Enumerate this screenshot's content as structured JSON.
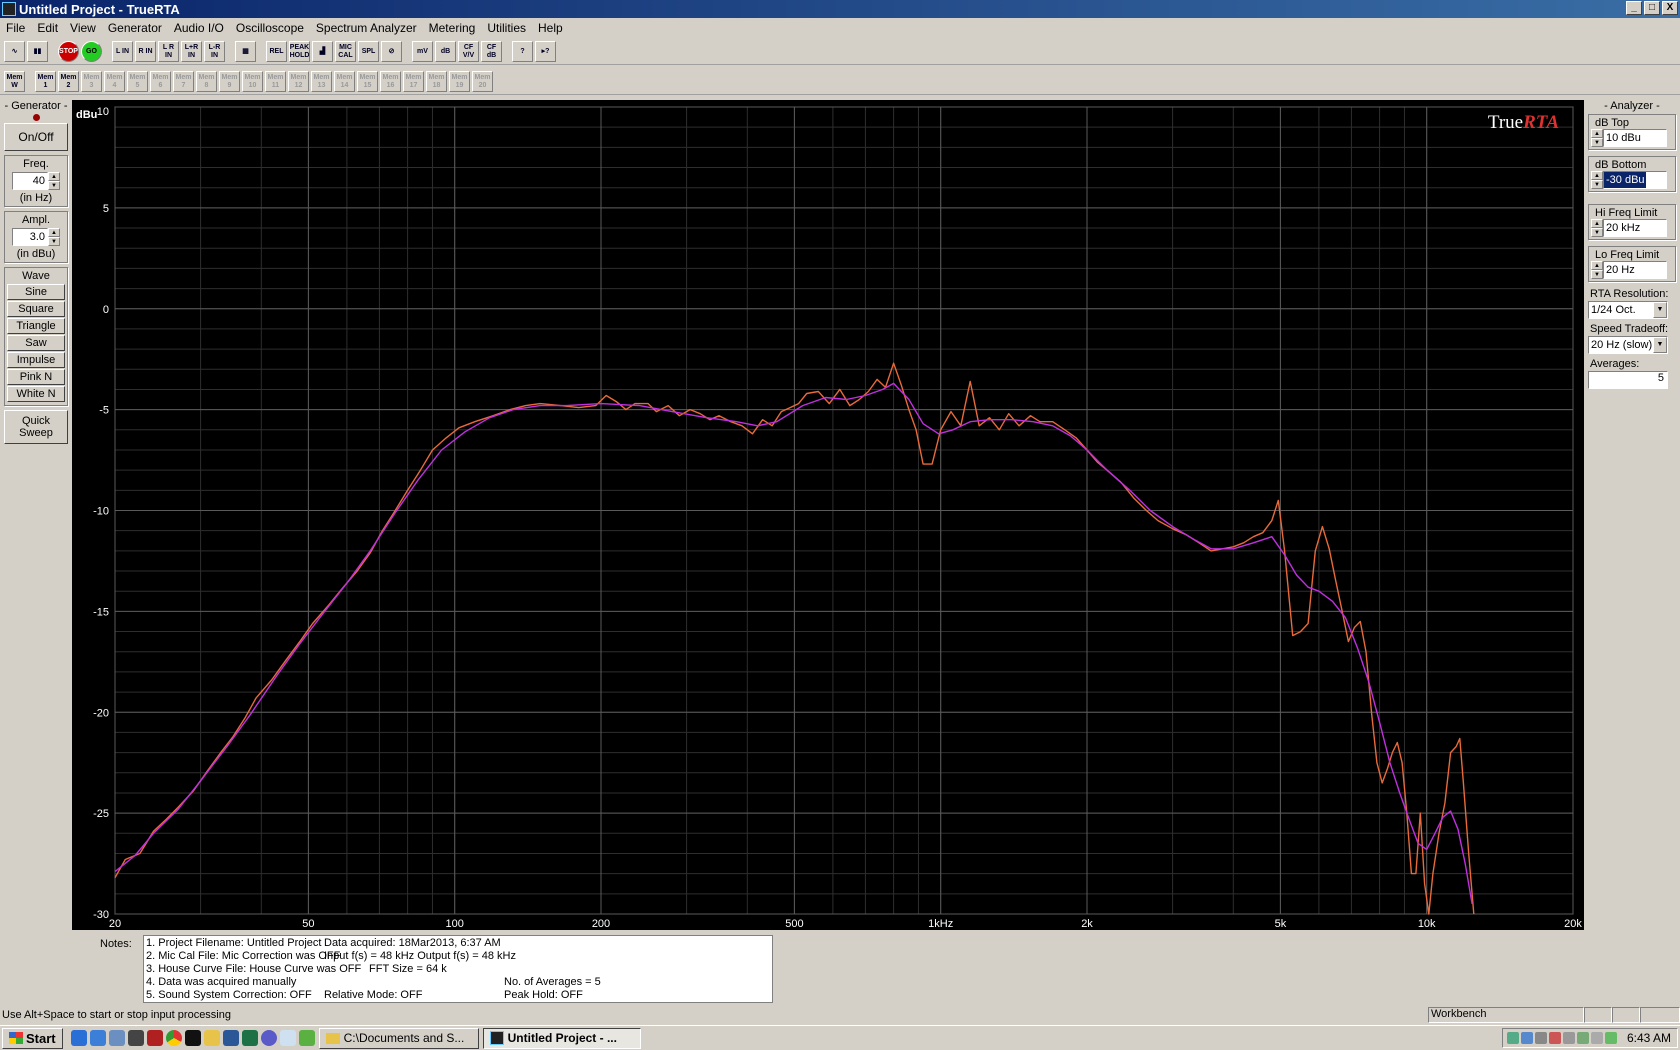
{
  "window": {
    "title": "Untitled Project - TrueRTA",
    "btn_min": "_",
    "btn_max": "□",
    "btn_close": "X"
  },
  "menu": [
    "File",
    "Edit",
    "View",
    "Generator",
    "Audio I/O",
    "Oscilloscope",
    "Spectrum Analyzer",
    "Metering",
    "Utilities",
    "Help"
  ],
  "toolbar1": [
    {
      "name": "scope-view-button",
      "label": "∿"
    },
    {
      "name": "rta-view-button",
      "label": "▮▮"
    },
    {
      "name": "stop-button",
      "label": "STOP"
    },
    {
      "name": "go-button",
      "label": "GO"
    },
    {
      "name": "left-input-button",
      "label": "L IN"
    },
    {
      "name": "right-input-button",
      "label": "R IN"
    },
    {
      "name": "lr-input-button",
      "label": "L R IN"
    },
    {
      "name": "l-plus-r-input-button",
      "label": "L+R IN"
    },
    {
      "name": "l-minus-r-input-button",
      "label": "L-R IN"
    },
    {
      "name": "grid-button",
      "label": "▦"
    },
    {
      "name": "relative-button",
      "label": "REL"
    },
    {
      "name": "peak-hold-button",
      "label": "PEAK HOLD"
    },
    {
      "name": "bar-graph-button",
      "label": "▟"
    },
    {
      "name": "mic-cal-button",
      "label": "MIC CAL"
    },
    {
      "name": "spl-button",
      "label": "SPL"
    },
    {
      "name": "clear-button",
      "label": "⊘"
    },
    {
      "name": "mv-button",
      "label": "mV"
    },
    {
      "name": "db-button",
      "label": "dB"
    },
    {
      "name": "cf-vv-button",
      "label": "CF V/V"
    },
    {
      "name": "cf-db-button",
      "label": "CF dB"
    },
    {
      "name": "help-button",
      "label": "?"
    },
    {
      "name": "context-help-button",
      "label": "▸?"
    }
  ],
  "toolbar2": [
    {
      "label": "Mem W",
      "dis": false
    },
    {
      "label": "Mem 1",
      "dis": false
    },
    {
      "label": "Mem 2",
      "dis": false
    },
    {
      "label": "Mem 3",
      "dis": true
    },
    {
      "label": "Mem 4",
      "dis": true
    },
    {
      "label": "Mem 5",
      "dis": true
    },
    {
      "label": "Mem 6",
      "dis": true
    },
    {
      "label": "Mem 7",
      "dis": true
    },
    {
      "label": "Mem 8",
      "dis": true
    },
    {
      "label": "Mem 9",
      "dis": true
    },
    {
      "label": "Mem 10",
      "dis": true
    },
    {
      "label": "Mem 11",
      "dis": true
    },
    {
      "label": "Mem 12",
      "dis": true
    },
    {
      "label": "Mem 13",
      "dis": true
    },
    {
      "label": "Mem 14",
      "dis": true
    },
    {
      "label": "Mem 15",
      "dis": true
    },
    {
      "label": "Mem 16",
      "dis": true
    },
    {
      "label": "Mem 17",
      "dis": true
    },
    {
      "label": "Mem 18",
      "dis": true
    },
    {
      "label": "Mem 19",
      "dis": true
    },
    {
      "label": "Mem 20",
      "dis": true
    }
  ],
  "generator": {
    "title": "- Generator -",
    "onoff": "On/Off",
    "freq_label": "Freq.",
    "freq_value": "40",
    "freq_unit": "(in Hz)",
    "ampl_label": "Ampl.",
    "ampl_value": "3.0",
    "ampl_unit": "(in dBu)",
    "wave_label": "Wave",
    "waves": [
      "Sine",
      "Square",
      "Triangle",
      "Saw",
      "Impulse",
      "Pink N",
      "White N"
    ],
    "quick_sweep": "Quick Sweep"
  },
  "analyzer": {
    "title": "- Analyzer -",
    "db_top_label": "dB Top",
    "db_top_value": "10 dBu",
    "db_bottom_label": "dB Bottom",
    "db_bottom_value": "-30 dBu",
    "hi_freq_label": "Hi Freq Limit",
    "hi_freq_value": "20 kHz",
    "lo_freq_label": "Lo Freq Limit",
    "lo_freq_value": "20 Hz",
    "resolution_label": "RTA Resolution:",
    "resolution_value": "1/24 Oct.",
    "speed_label": "Speed Tradeoff:",
    "speed_value": "20 Hz (slow)",
    "averages_label": "Averages:",
    "averages_value": "5"
  },
  "chart_data": {
    "type": "line",
    "brand": "TrueRTA",
    "ylabel": "dBu",
    "ylim": [
      -30,
      10
    ],
    "xlim": [
      20,
      20000
    ],
    "xscale": "log",
    "yticks": [
      10,
      5,
      0,
      -5,
      -10,
      -15,
      -20,
      -25,
      -30
    ],
    "xticks": [
      {
        "v": 20,
        "t": "20"
      },
      {
        "v": 50,
        "t": "50"
      },
      {
        "v": 100,
        "t": "100"
      },
      {
        "v": 200,
        "t": "200"
      },
      {
        "v": 500,
        "t": "500"
      },
      {
        "v": 1000,
        "t": "1kHz"
      },
      {
        "v": 2000,
        "t": "2k"
      },
      {
        "v": 5000,
        "t": "5k"
      },
      {
        "v": 10000,
        "t": "10k"
      },
      {
        "v": 20000,
        "t": "20k"
      }
    ],
    "grid": true,
    "series": [
      {
        "color": "#e86a3a",
        "points": [
          [
            20,
            -28.2
          ],
          [
            21,
            -27.3
          ],
          [
            22.5,
            -27.0
          ],
          [
            24,
            -25.9
          ],
          [
            25.5,
            -25.3
          ],
          [
            27,
            -24.7
          ],
          [
            29,
            -23.9
          ],
          [
            31,
            -22.9
          ],
          [
            33,
            -22.0
          ],
          [
            35,
            -21.2
          ],
          [
            37,
            -20.3
          ],
          [
            39,
            -19.3
          ],
          [
            42,
            -18.4
          ],
          [
            45,
            -17.4
          ],
          [
            48,
            -16.5
          ],
          [
            51,
            -15.6
          ],
          [
            55,
            -14.7
          ],
          [
            59,
            -13.8
          ],
          [
            63,
            -13.0
          ],
          [
            67,
            -12.1
          ],
          [
            71,
            -11.0
          ],
          [
            75,
            -10.1
          ],
          [
            80,
            -9.0
          ],
          [
            85,
            -8.0
          ],
          [
            90,
            -7.0
          ],
          [
            96,
            -6.4
          ],
          [
            102,
            -5.9
          ],
          [
            110,
            -5.6
          ],
          [
            120,
            -5.3
          ],
          [
            130,
            -5.0
          ],
          [
            140,
            -4.8
          ],
          [
            150,
            -4.7
          ],
          [
            165,
            -4.8
          ],
          [
            180,
            -4.9
          ],
          [
            195,
            -4.8
          ],
          [
            205,
            -4.3
          ],
          [
            215,
            -4.6
          ],
          [
            225,
            -5.0
          ],
          [
            235,
            -4.7
          ],
          [
            250,
            -4.7
          ],
          [
            260,
            -5.1
          ],
          [
            275,
            -4.8
          ],
          [
            290,
            -5.3
          ],
          [
            305,
            -5.0
          ],
          [
            320,
            -5.2
          ],
          [
            335,
            -5.5
          ],
          [
            350,
            -5.3
          ],
          [
            370,
            -5.6
          ],
          [
            390,
            -5.8
          ],
          [
            410,
            -6.2
          ],
          [
            430,
            -5.5
          ],
          [
            450,
            -5.8
          ],
          [
            470,
            -5.1
          ],
          [
            490,
            -4.9
          ],
          [
            510,
            -4.7
          ],
          [
            530,
            -4.2
          ],
          [
            560,
            -4.1
          ],
          [
            590,
            -4.7
          ],
          [
            620,
            -4.0
          ],
          [
            650,
            -4.8
          ],
          [
            680,
            -4.5
          ],
          [
            710,
            -4.1
          ],
          [
            740,
            -3.5
          ],
          [
            770,
            -3.9
          ],
          [
            800,
            -2.7
          ],
          [
            830,
            -3.8
          ],
          [
            860,
            -5.0
          ],
          [
            890,
            -6.0
          ],
          [
            920,
            -7.7
          ],
          [
            960,
            -7.7
          ],
          [
            1000,
            -6.0
          ],
          [
            1050,
            -5.1
          ],
          [
            1100,
            -5.8
          ],
          [
            1150,
            -3.6
          ],
          [
            1200,
            -5.8
          ],
          [
            1260,
            -5.4
          ],
          [
            1320,
            -6.0
          ],
          [
            1380,
            -5.2
          ],
          [
            1450,
            -5.8
          ],
          [
            1530,
            -5.3
          ],
          [
            1600,
            -5.6
          ],
          [
            1700,
            -5.6
          ],
          [
            1800,
            -6.0
          ],
          [
            1900,
            -6.4
          ],
          [
            2000,
            -7.0
          ],
          [
            2100,
            -7.6
          ],
          [
            2200,
            -8.0
          ],
          [
            2350,
            -8.6
          ],
          [
            2500,
            -9.4
          ],
          [
            2650,
            -10.0
          ],
          [
            2800,
            -10.5
          ],
          [
            3000,
            -10.9
          ],
          [
            3200,
            -11.2
          ],
          [
            3400,
            -11.6
          ],
          [
            3600,
            -12.0
          ],
          [
            3800,
            -11.9
          ],
          [
            4000,
            -11.8
          ],
          [
            4200,
            -11.6
          ],
          [
            4400,
            -11.3
          ],
          [
            4600,
            -11.1
          ],
          [
            4800,
            -10.5
          ],
          [
            4950,
            -9.5
          ],
          [
            5100,
            -12.0
          ],
          [
            5300,
            -16.2
          ],
          [
            5500,
            -16.0
          ],
          [
            5700,
            -15.6
          ],
          [
            5900,
            -12.0
          ],
          [
            6100,
            -10.8
          ],
          [
            6300,
            -11.9
          ],
          [
            6500,
            -13.5
          ],
          [
            6700,
            -15.0
          ],
          [
            6900,
            -16.5
          ],
          [
            7100,
            -15.8
          ],
          [
            7300,
            -15.5
          ],
          [
            7500,
            -17.0
          ],
          [
            7700,
            -20.0
          ],
          [
            7900,
            -22.5
          ],
          [
            8100,
            -23.5
          ],
          [
            8300,
            -22.8
          ],
          [
            8500,
            -22.0
          ],
          [
            8700,
            -21.5
          ],
          [
            8900,
            -22.5
          ],
          [
            9100,
            -25.0
          ],
          [
            9300,
            -28.0
          ],
          [
            9500,
            -28.0
          ],
          [
            9700,
            -25.0
          ],
          [
            9900,
            -28.5
          ],
          [
            10100,
            -30.0
          ],
          [
            10300,
            -28.0
          ],
          [
            10600,
            -26.0
          ],
          [
            10900,
            -24.5
          ],
          [
            11200,
            -22.0
          ],
          [
            11500,
            -21.7
          ],
          [
            11700,
            -21.3
          ],
          [
            11900,
            -23.5
          ],
          [
            12200,
            -27.0
          ],
          [
            12500,
            -30.0
          ]
        ]
      },
      {
        "color": "#c030e0",
        "points": [
          [
            20,
            -27.9
          ],
          [
            22,
            -27.1
          ],
          [
            24,
            -26.0
          ],
          [
            27,
            -24.8
          ],
          [
            30,
            -23.4
          ],
          [
            34,
            -21.7
          ],
          [
            38,
            -20.1
          ],
          [
            43,
            -18.2
          ],
          [
            48,
            -16.6
          ],
          [
            54,
            -15.0
          ],
          [
            60,
            -13.6
          ],
          [
            67,
            -12.0
          ],
          [
            75,
            -10.2
          ],
          [
            84,
            -8.5
          ],
          [
            94,
            -7.0
          ],
          [
            105,
            -6.1
          ],
          [
            118,
            -5.4
          ],
          [
            132,
            -5.0
          ],
          [
            150,
            -4.8
          ],
          [
            170,
            -4.8
          ],
          [
            200,
            -4.7
          ],
          [
            240,
            -4.8
          ],
          [
            280,
            -5.1
          ],
          [
            330,
            -5.4
          ],
          [
            380,
            -5.6
          ],
          [
            420,
            -5.8
          ],
          [
            460,
            -5.6
          ],
          [
            520,
            -4.8
          ],
          [
            580,
            -4.4
          ],
          [
            640,
            -4.5
          ],
          [
            700,
            -4.3
          ],
          [
            760,
            -4.0
          ],
          [
            800,
            -3.7
          ],
          [
            860,
            -4.5
          ],
          [
            920,
            -5.7
          ],
          [
            990,
            -6.2
          ],
          [
            1060,
            -6.0
          ],
          [
            1150,
            -5.6
          ],
          [
            1260,
            -5.5
          ],
          [
            1400,
            -5.5
          ],
          [
            1550,
            -5.6
          ],
          [
            1700,
            -5.8
          ],
          [
            1850,
            -6.3
          ],
          [
            2000,
            -7.0
          ],
          [
            2200,
            -8.0
          ],
          [
            2450,
            -9.0
          ],
          [
            2700,
            -10.0
          ],
          [
            3000,
            -10.8
          ],
          [
            3300,
            -11.4
          ],
          [
            3600,
            -11.9
          ],
          [
            4000,
            -11.9
          ],
          [
            4400,
            -11.6
          ],
          [
            4800,
            -11.3
          ],
          [
            5100,
            -12.2
          ],
          [
            5400,
            -13.2
          ],
          [
            5700,
            -13.8
          ],
          [
            6000,
            -14.0
          ],
          [
            6400,
            -14.5
          ],
          [
            6800,
            -15.3
          ],
          [
            7200,
            -16.8
          ],
          [
            7600,
            -18.5
          ],
          [
            8000,
            -20.5
          ],
          [
            8400,
            -22.5
          ],
          [
            8800,
            -24.0
          ],
          [
            9200,
            -25.3
          ],
          [
            9600,
            -26.5
          ],
          [
            10000,
            -26.8
          ],
          [
            10400,
            -26.0
          ],
          [
            10800,
            -25.2
          ],
          [
            11200,
            -24.9
          ],
          [
            11600,
            -25.8
          ],
          [
            12000,
            -27.5
          ],
          [
            12400,
            -29.5
          ]
        ]
      }
    ]
  },
  "notes": {
    "label": "Notes:",
    "lines": [
      [
        "1. Project Filename: Untitled Project",
        "Data acquired: 18Mar2013, 6:37 AM",
        ""
      ],
      [
        "2. Mic Cal File: Mic Correction was OFF",
        "Input f(s) = 48 kHz   Output f(s) = 48 kHz",
        ""
      ],
      [
        "3. House Curve File: House Curve was OFF",
        "FFT Size = 64 k",
        ""
      ],
      [
        "4. Data was acquired manually",
        "",
        "No. of Averages = 5"
      ],
      [
        "5. Sound System Correction: OFF",
        "Relative Mode:  OFF",
        "Peak Hold: OFF"
      ]
    ]
  },
  "status": {
    "hint": "Use Alt+Space to start or stop input processing",
    "mode": "Workbench"
  },
  "taskbar": {
    "start": "Start",
    "tasks": [
      "C:\\Documents and S...",
      "Untitled Project - ..."
    ],
    "clock": "6:43 AM"
  }
}
